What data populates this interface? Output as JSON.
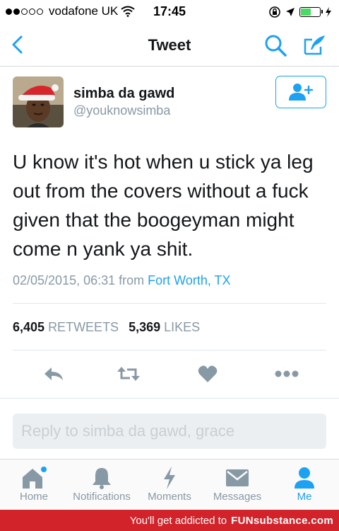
{
  "status_bar": {
    "carrier": "vodafone UK",
    "time": "17:45",
    "signal_bars_filled": 2,
    "signal_bars_total": 5
  },
  "nav": {
    "title": "Tweet",
    "back_icon": "chevron-left-icon",
    "search_icon": "search-icon",
    "compose_icon": "compose-icon"
  },
  "tweet": {
    "display_name": "simba da gawd",
    "handle": "@youknowsimba",
    "text": "U know it's hot when u stick ya leg out from the covers without a fuck given that the boogeyman might come n yank ya shit.",
    "timestamp": "02/05/2015, 06:31",
    "from_label": "from",
    "location": "Fort Worth, TX",
    "retweets_count": "6,405",
    "retweets_label": "RETWEETS",
    "likes_count": "5,369",
    "likes_label": "LIKES"
  },
  "reply": {
    "placeholder": "Reply to simba da gawd, grace"
  },
  "tabs": [
    {
      "label": "Home",
      "icon": "home-icon"
    },
    {
      "label": "Notifications",
      "icon": "bell-icon"
    },
    {
      "label": "Moments",
      "icon": "lightning-icon"
    },
    {
      "label": "Messages",
      "icon": "envelope-icon"
    },
    {
      "label": "Me",
      "icon": "person-icon"
    }
  ],
  "footer": {
    "text": "You'll get addicted to",
    "brand": "FUNsubstance.com"
  },
  "colors": {
    "accent": "#1da1f2",
    "muted": "#8899a6",
    "footer_bg": "#d2232a"
  }
}
